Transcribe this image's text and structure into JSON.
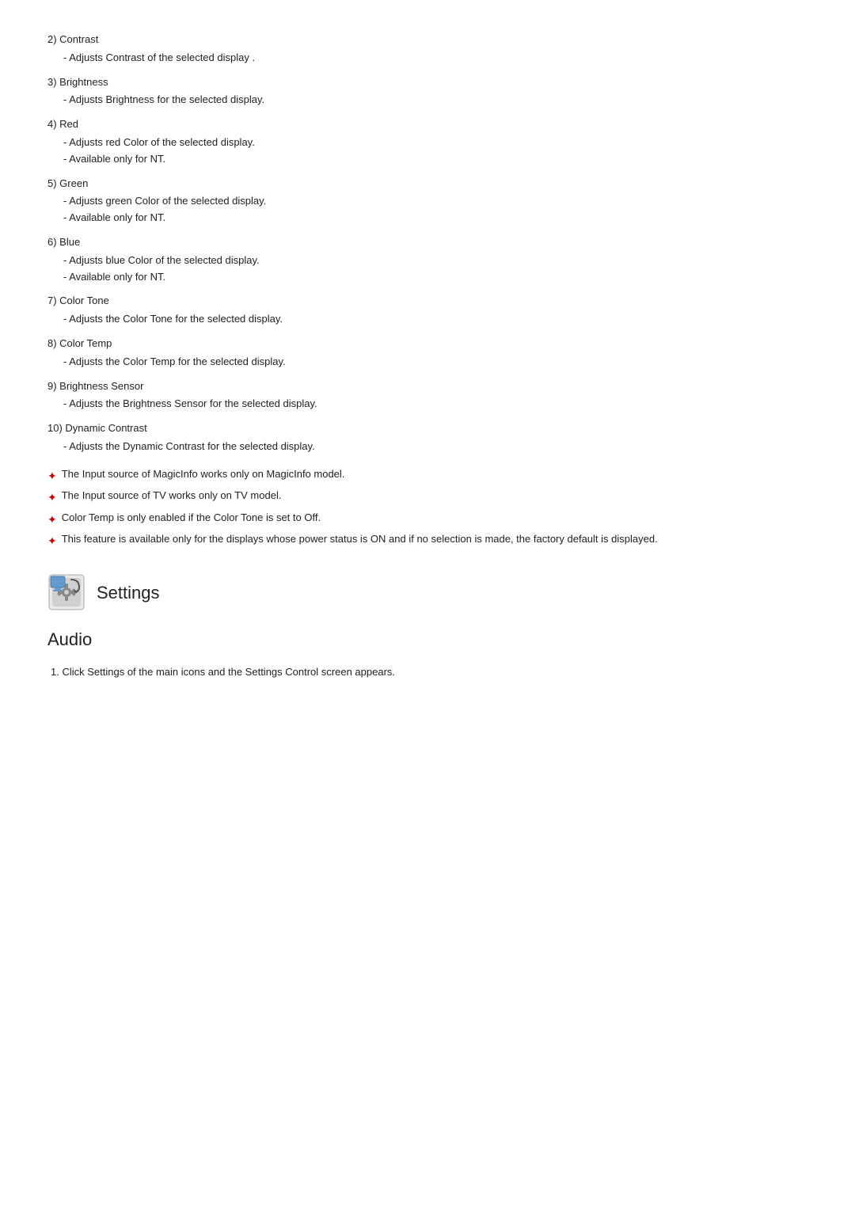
{
  "items": [
    {
      "number": "2)",
      "title": "Contrast",
      "descriptions": [
        "- Adjusts Contrast of the selected display ."
      ]
    },
    {
      "number": "3)",
      "title": "Brightness",
      "descriptions": [
        "- Adjusts Brightness for the selected display."
      ]
    },
    {
      "number": "4)",
      "title": "Red",
      "descriptions": [
        "- Adjusts red Color of the selected display.",
        "- Available  only for NT."
      ]
    },
    {
      "number": "5)",
      "title": "Green",
      "descriptions": [
        "- Adjusts green Color of the selected display.",
        "- Available  only for NT."
      ]
    },
    {
      "number": "6)",
      "title": "Blue",
      "descriptions": [
        "- Adjusts blue Color of the selected display.",
        "- Available  only for NT."
      ]
    },
    {
      "number": "7)",
      "title": "Color Tone",
      "descriptions": [
        "- Adjusts the Color Tone for the selected display."
      ]
    },
    {
      "number": "8)",
      "title": "Color Temp",
      "descriptions": [
        "- Adjusts the Color Temp for the selected display."
      ]
    },
    {
      "number": "9)",
      "title": "Brightness Sensor",
      "descriptions": [
        "- Adjusts the Brightness Sensor for the selected display."
      ]
    },
    {
      "number": "10)",
      "title": "Dynamic Contrast",
      "descriptions": [
        "- Adjusts the Dynamic Contrast for the selected display."
      ]
    }
  ],
  "notes": [
    "The Input source of MagicInfo works only on MagicInfo model.",
    "The Input source of TV works only on TV model.",
    "Color Temp is only enabled if the Color Tone is set to Off.",
    "This feature is available only for the displays whose power status is ON and if no selection is made, the factory default is displayed."
  ],
  "section": {
    "title": "Settings",
    "icon_alt": "Settings icon"
  },
  "subsection": {
    "title": "Audio",
    "steps": [
      "1.  Click Settings of the main icons and the Settings Control screen appears."
    ]
  }
}
